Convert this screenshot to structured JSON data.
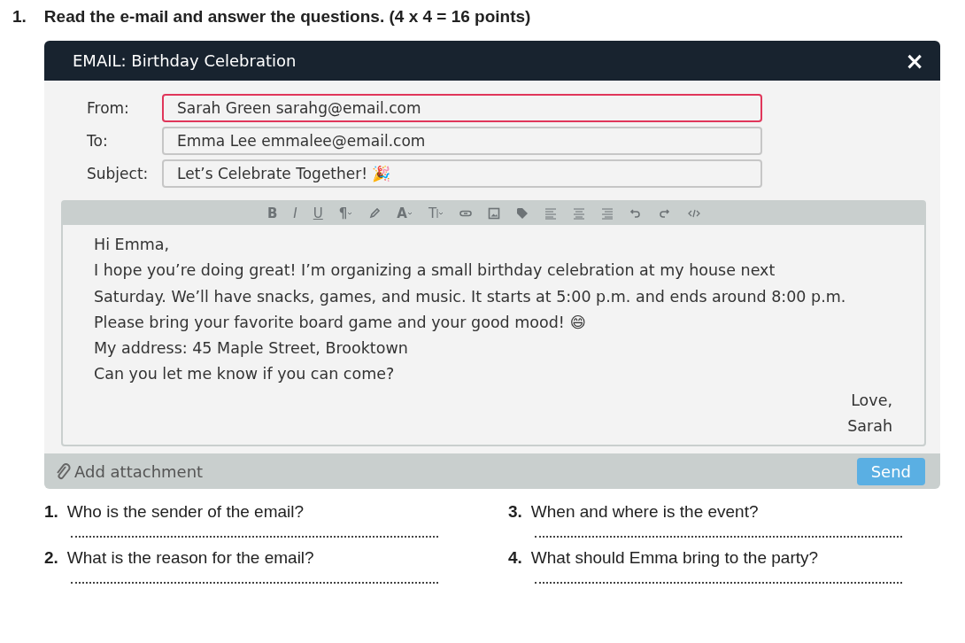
{
  "task": {
    "number": "1.",
    "instruction": "Read the e-mail and answer the questions. (4 x 4 = 16 points)"
  },
  "window": {
    "title": "EMAIL: Birthday Celebration",
    "close": "×"
  },
  "fields": [
    {
      "label": "From:",
      "value": "Sarah Green sarahg@email.com",
      "highlighted": true
    },
    {
      "label": "To:",
      "value": "Emma Lee emmalee@email.com",
      "highlighted": false
    },
    {
      "label": "Subject:",
      "value": "Let’s Celebrate Together! 🎉",
      "highlighted": false
    }
  ],
  "toolbar": [
    {
      "kind": "bold",
      "label": "B"
    },
    {
      "kind": "italic",
      "label": "I"
    },
    {
      "kind": "underline",
      "label": "U"
    },
    {
      "kind": "paragraph",
      "label": "¶"
    },
    {
      "kind": "pen"
    },
    {
      "kind": "font-size",
      "label": "A"
    },
    {
      "kind": "text-style",
      "label": "T"
    },
    {
      "kind": "link"
    },
    {
      "kind": "image"
    },
    {
      "kind": "tag"
    },
    {
      "kind": "align-left"
    },
    {
      "kind": "align-center"
    },
    {
      "kind": "align-right"
    },
    {
      "kind": "undo"
    },
    {
      "kind": "redo"
    },
    {
      "kind": "code"
    }
  ],
  "body": {
    "lines": [
      "Hi Emma,",
      "I hope you’re doing great! I’m organizing a small birthday celebration at my house next",
      "Saturday. We’ll have snacks, games, and music. It starts at 5:00 p.m. and ends around 8:00 p.m.",
      "Please bring your favorite board game and your good mood! 😄",
      "My address: 45 Maple Street, Brooktown",
      "Can you let me know if you can come?"
    ],
    "closing": [
      "Love,",
      "Sarah"
    ]
  },
  "footer": {
    "attachment": "Add attachment",
    "send": "Send"
  },
  "questions": [
    {
      "number": "1.",
      "text": "Who is the sender of the email?"
    },
    {
      "number": "3.",
      "text": "When and where is the event?"
    },
    {
      "number": "2.",
      "text": "What is the reason for the email?"
    },
    {
      "number": "4.",
      "text": "What should Emma bring to the party?"
    }
  ]
}
